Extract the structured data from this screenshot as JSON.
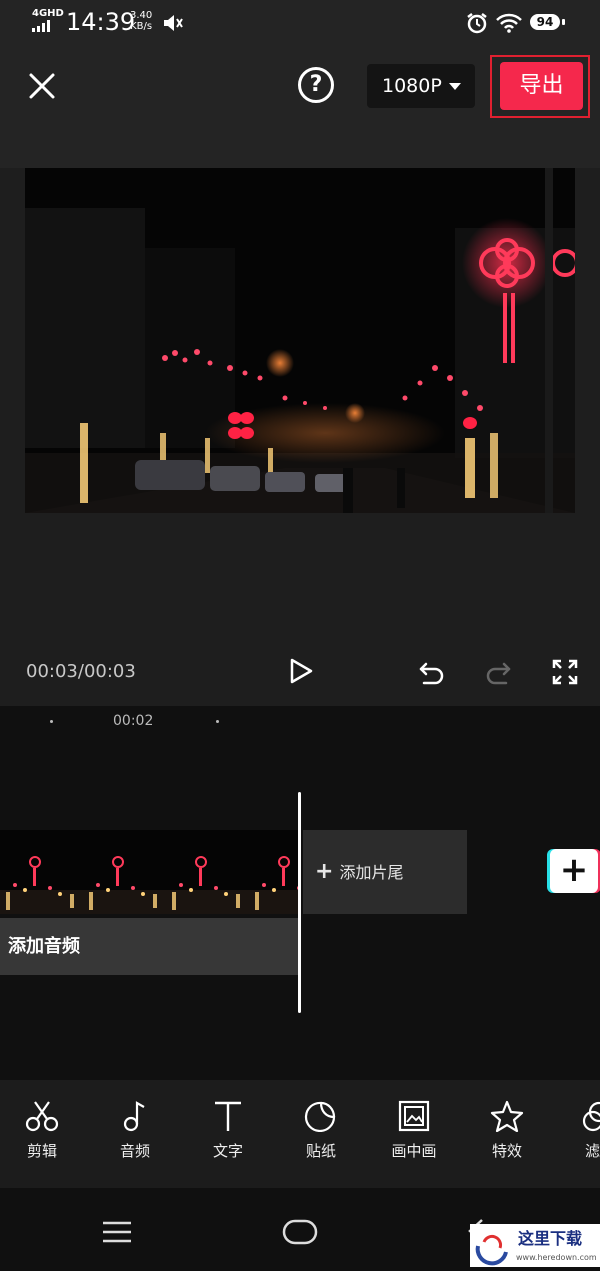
{
  "status_bar": {
    "network": "4GHD",
    "time": "14:39",
    "speed_value": "3.40",
    "speed_unit": "KB/s",
    "battery": "94"
  },
  "toolbar": {
    "resolution": "1080P",
    "export_label": "导出",
    "help_label": "?"
  },
  "player": {
    "time_code": "00:03/00:03"
  },
  "timeline": {
    "ruler_label": "00:02",
    "add_ending_label": "添加片尾",
    "add_audio_label": "添加音频"
  },
  "tools": [
    {
      "label": "剪辑",
      "icon": "scissors-icon"
    },
    {
      "label": "音频",
      "icon": "music-note-icon"
    },
    {
      "label": "文字",
      "icon": "text-icon"
    },
    {
      "label": "贴纸",
      "icon": "sticker-icon"
    },
    {
      "label": "画中画",
      "icon": "picture-in-picture-icon"
    },
    {
      "label": "特效",
      "icon": "star-effect-icon"
    },
    {
      "label": "滤",
      "icon": "filter-icon"
    }
  ],
  "watermark": {
    "text": "这里下载",
    "subtext": "www.heredown.com"
  },
  "colors": {
    "export": "#f5284c",
    "background": "#101010",
    "panel": "#242424"
  }
}
